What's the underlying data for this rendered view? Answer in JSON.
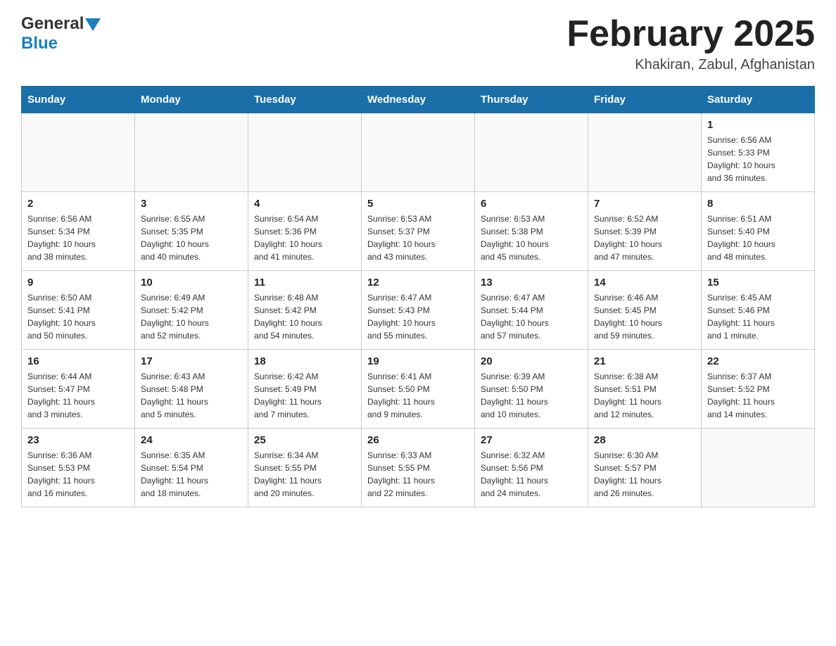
{
  "header": {
    "logo_general": "General",
    "logo_blue": "Blue",
    "title": "February 2025",
    "subtitle": "Khakiran, Zabul, Afghanistan"
  },
  "days_of_week": [
    "Sunday",
    "Monday",
    "Tuesday",
    "Wednesday",
    "Thursday",
    "Friday",
    "Saturday"
  ],
  "weeks": [
    [
      {
        "day": "",
        "info": ""
      },
      {
        "day": "",
        "info": ""
      },
      {
        "day": "",
        "info": ""
      },
      {
        "day": "",
        "info": ""
      },
      {
        "day": "",
        "info": ""
      },
      {
        "day": "",
        "info": ""
      },
      {
        "day": "1",
        "info": "Sunrise: 6:56 AM\nSunset: 5:33 PM\nDaylight: 10 hours\nand 36 minutes."
      }
    ],
    [
      {
        "day": "2",
        "info": "Sunrise: 6:56 AM\nSunset: 5:34 PM\nDaylight: 10 hours\nand 38 minutes."
      },
      {
        "day": "3",
        "info": "Sunrise: 6:55 AM\nSunset: 5:35 PM\nDaylight: 10 hours\nand 40 minutes."
      },
      {
        "day": "4",
        "info": "Sunrise: 6:54 AM\nSunset: 5:36 PM\nDaylight: 10 hours\nand 41 minutes."
      },
      {
        "day": "5",
        "info": "Sunrise: 6:53 AM\nSunset: 5:37 PM\nDaylight: 10 hours\nand 43 minutes."
      },
      {
        "day": "6",
        "info": "Sunrise: 6:53 AM\nSunset: 5:38 PM\nDaylight: 10 hours\nand 45 minutes."
      },
      {
        "day": "7",
        "info": "Sunrise: 6:52 AM\nSunset: 5:39 PM\nDaylight: 10 hours\nand 47 minutes."
      },
      {
        "day": "8",
        "info": "Sunrise: 6:51 AM\nSunset: 5:40 PM\nDaylight: 10 hours\nand 48 minutes."
      }
    ],
    [
      {
        "day": "9",
        "info": "Sunrise: 6:50 AM\nSunset: 5:41 PM\nDaylight: 10 hours\nand 50 minutes."
      },
      {
        "day": "10",
        "info": "Sunrise: 6:49 AM\nSunset: 5:42 PM\nDaylight: 10 hours\nand 52 minutes."
      },
      {
        "day": "11",
        "info": "Sunrise: 6:48 AM\nSunset: 5:42 PM\nDaylight: 10 hours\nand 54 minutes."
      },
      {
        "day": "12",
        "info": "Sunrise: 6:47 AM\nSunset: 5:43 PM\nDaylight: 10 hours\nand 55 minutes."
      },
      {
        "day": "13",
        "info": "Sunrise: 6:47 AM\nSunset: 5:44 PM\nDaylight: 10 hours\nand 57 minutes."
      },
      {
        "day": "14",
        "info": "Sunrise: 6:46 AM\nSunset: 5:45 PM\nDaylight: 10 hours\nand 59 minutes."
      },
      {
        "day": "15",
        "info": "Sunrise: 6:45 AM\nSunset: 5:46 PM\nDaylight: 11 hours\nand 1 minute."
      }
    ],
    [
      {
        "day": "16",
        "info": "Sunrise: 6:44 AM\nSunset: 5:47 PM\nDaylight: 11 hours\nand 3 minutes."
      },
      {
        "day": "17",
        "info": "Sunrise: 6:43 AM\nSunset: 5:48 PM\nDaylight: 11 hours\nand 5 minutes."
      },
      {
        "day": "18",
        "info": "Sunrise: 6:42 AM\nSunset: 5:49 PM\nDaylight: 11 hours\nand 7 minutes."
      },
      {
        "day": "19",
        "info": "Sunrise: 6:41 AM\nSunset: 5:50 PM\nDaylight: 11 hours\nand 9 minutes."
      },
      {
        "day": "20",
        "info": "Sunrise: 6:39 AM\nSunset: 5:50 PM\nDaylight: 11 hours\nand 10 minutes."
      },
      {
        "day": "21",
        "info": "Sunrise: 6:38 AM\nSunset: 5:51 PM\nDaylight: 11 hours\nand 12 minutes."
      },
      {
        "day": "22",
        "info": "Sunrise: 6:37 AM\nSunset: 5:52 PM\nDaylight: 11 hours\nand 14 minutes."
      }
    ],
    [
      {
        "day": "23",
        "info": "Sunrise: 6:36 AM\nSunset: 5:53 PM\nDaylight: 11 hours\nand 16 minutes."
      },
      {
        "day": "24",
        "info": "Sunrise: 6:35 AM\nSunset: 5:54 PM\nDaylight: 11 hours\nand 18 minutes."
      },
      {
        "day": "25",
        "info": "Sunrise: 6:34 AM\nSunset: 5:55 PM\nDaylight: 11 hours\nand 20 minutes."
      },
      {
        "day": "26",
        "info": "Sunrise: 6:33 AM\nSunset: 5:55 PM\nDaylight: 11 hours\nand 22 minutes."
      },
      {
        "day": "27",
        "info": "Sunrise: 6:32 AM\nSunset: 5:56 PM\nDaylight: 11 hours\nand 24 minutes."
      },
      {
        "day": "28",
        "info": "Sunrise: 6:30 AM\nSunset: 5:57 PM\nDaylight: 11 hours\nand 26 minutes."
      },
      {
        "day": "",
        "info": ""
      }
    ]
  ]
}
